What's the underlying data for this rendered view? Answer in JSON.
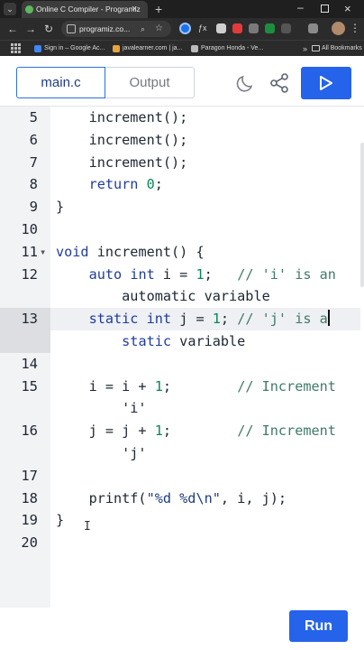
{
  "browser": {
    "tab_title": "Online C Compiler - Programiz",
    "tab_close": "×",
    "new_tab": "+",
    "url": "programiz.co...",
    "dropdown": "⌄",
    "ext_fx": "ƒx",
    "bookmarks": [
      {
        "label": "Sign in – Google Ac...",
        "color": "#4285f4"
      },
      {
        "label": "javalearner.com | ja...",
        "color": "#e8a33d"
      },
      {
        "label": "Paragon Honda - Ve...",
        "color": "#bbbbbb"
      }
    ],
    "bookmarks_more": "»",
    "all_bookmarks": "All Bookmarks"
  },
  "header": {
    "tab_main": "main.c",
    "tab_output": "Output"
  },
  "editor": {
    "lines": [
      {
        "n": "5",
        "fold": "",
        "code": "    increment();"
      },
      {
        "n": "6",
        "fold": "",
        "code": "    increment();"
      },
      {
        "n": "7",
        "fold": "",
        "code": "    increment();"
      },
      {
        "n": "8",
        "fold": "",
        "code": "    return 0;"
      },
      {
        "n": "9",
        "fold": "",
        "code": "}"
      },
      {
        "n": "10",
        "fold": "",
        "code": ""
      },
      {
        "n": "11",
        "fold": "▾",
        "code": "void increment() {"
      },
      {
        "n": "12",
        "fold": "",
        "code": "    auto int i = 1;   // 'i' is an"
      },
      {
        "n": "",
        "fold": "",
        "code": "        automatic variable"
      },
      {
        "n": "13",
        "fold": "",
        "code": "    static int j = 1; // 'j' is a"
      },
      {
        "n": "",
        "fold": "",
        "code": "        static variable"
      },
      {
        "n": "14",
        "fold": "",
        "code": ""
      },
      {
        "n": "15",
        "fold": "",
        "code": "    i = i + 1;        // Increment"
      },
      {
        "n": "",
        "fold": "",
        "code": "        'i'"
      },
      {
        "n": "16",
        "fold": "",
        "code": "    j = j + 1;        // Increment"
      },
      {
        "n": "",
        "fold": "",
        "code": "        'j'"
      },
      {
        "n": "17",
        "fold": "",
        "code": ""
      },
      {
        "n": "18",
        "fold": "",
        "code": "    printf(\"%d %d\\n\", i, j);"
      },
      {
        "n": "19",
        "fold": "",
        "code": "}"
      },
      {
        "n": "20",
        "fold": "",
        "code": ""
      }
    ]
  },
  "run_label": "Run",
  "colors": {
    "accent": "#2563eb",
    "keyword": "#1f3c9c",
    "comment": "#3f7a6a"
  }
}
